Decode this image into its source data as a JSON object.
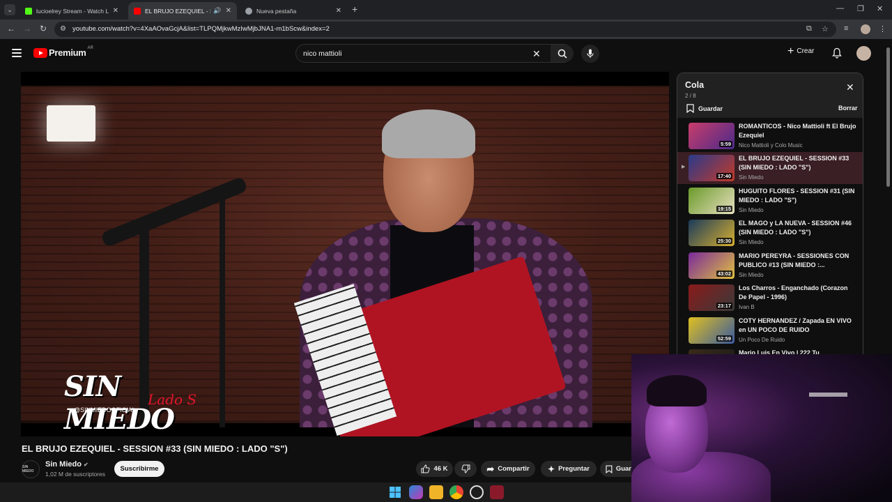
{
  "browser": {
    "tabs": [
      {
        "label": "lucioelrey Stream - Watch Live o",
        "favicon_color": "#53fc18",
        "active": false
      },
      {
        "label": "EL BRUJO EZEQUIEL - SESSI",
        "favicon_color": "#ff0000",
        "active": true
      },
      {
        "label": "Nueva pestaña",
        "favicon_color": "#9aa0a6",
        "active": false
      }
    ],
    "url": "youtube.com/watch?v=4XaAOvaGcjA&list=TLPQMjkwMzIwMjbJNA1-m1bScw&index=2"
  },
  "youtube": {
    "logo_text": "Premium",
    "country_code": "AR",
    "search_value": "nico mattioli",
    "create_label": "Crear"
  },
  "video": {
    "overlay_brand": "SIN MIEDO",
    "overlay_sub": "Lado S",
    "overlay_handle": "@SINMIEDOOFICIAL",
    "title": "EL BRUJO EZEQUIEL - SESSION #33 (SIN MIEDO : LADO \"S\")",
    "channel_name": "Sin Miedo",
    "channel_avatar_text": "SIN MIEDO",
    "subscribers": "1,02 M de suscriptores",
    "subscribe_label": "Suscribirme",
    "likes": "46 K",
    "share_label": "Compartir",
    "ask_label": "Preguntar",
    "save_label": "Guar"
  },
  "queue": {
    "title": "Cola",
    "position": "2 / 8",
    "save_label": "Guardar",
    "clear_label": "Borrar",
    "items": [
      {
        "title": "ROMANTICOS - Nico Mattioli ft El Brujo Ezequiel",
        "channel": "Nico Mattioli y Colo Music",
        "duration": "5:59",
        "color": "#7a3b8a",
        "active": false
      },
      {
        "title": "EL BRUJO EZEQUIEL - SESSION #33 (SIN MIEDO : LADO \"S\")",
        "channel": "Sin Miedo",
        "duration": "17:40",
        "color": "#8a2a3a",
        "active": true
      },
      {
        "title": "HUGUITO FLORES - SESSION #31 (SIN MIEDO : LADO \"S\")",
        "channel": "Sin Miedo",
        "duration": "19:15",
        "color": "#4a7a2a",
        "active": false
      },
      {
        "title": "EL MAGO y LA NUEVA - SESSION #46 (SIN MIEDO : LADO \"S\")",
        "channel": "Sin Miedo",
        "duration": "25:30",
        "color": "#2a6a4a",
        "active": false
      },
      {
        "title": "MARIO PEREYRA - SESSIONES CON PUBLICO #13 (SIN MIEDO :...",
        "channel": "Sin Miedo",
        "duration": "43:02",
        "color": "#5a2a7a",
        "active": false
      },
      {
        "title": "Los Charros - Enganchado (Corazon De Papel - 1996)",
        "channel": "Ivan B",
        "duration": "23:17",
        "color": "#6a2a2a",
        "active": false
      },
      {
        "title": "COTY HERNANDEZ / Zapada EN VIVO en UN POCO DE RUIDO",
        "channel": "Un Poco De Ruido",
        "duration": "52:59",
        "color": "#a8821a",
        "active": false
      },
      {
        "title": "Mario Luis En Vivo | 222 Tu",
        "channel": "",
        "duration": "",
        "color": "#3a2a1a",
        "active": false
      }
    ]
  }
}
